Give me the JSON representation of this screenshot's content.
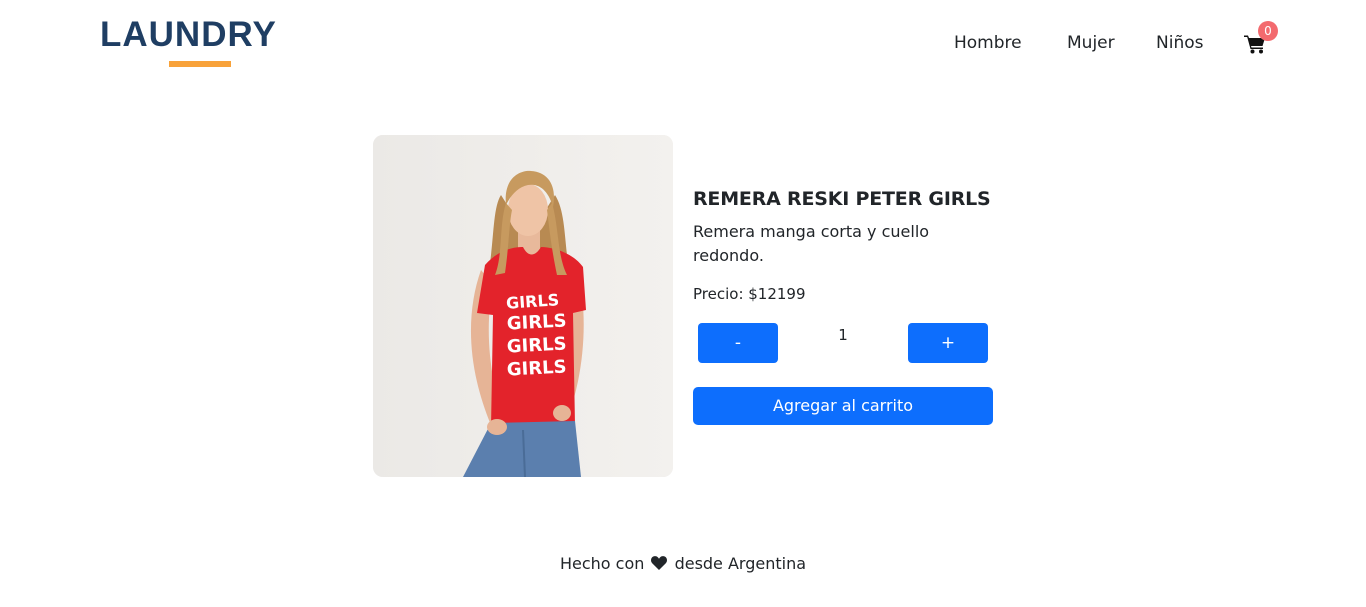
{
  "header": {
    "logo": "LAUNDRY",
    "nav": [
      "Hombre",
      "Mujer",
      "Niños"
    ],
    "cart_count": "0"
  },
  "product": {
    "title": "REMERA RESKI PETER GIRLS",
    "description": "Remera manga corta y cuello redondo.",
    "price": "Precio: $12199",
    "shirt_text": [
      "GIRLS",
      "GIRLS",
      "GIRLS",
      "GIRLS"
    ],
    "quantity": "1",
    "minus_label": "-",
    "plus_label": "+",
    "add_to_cart_label": "Agregar al carrito"
  },
  "footer": {
    "before_heart": "Hecho con",
    "after_heart": "desde Argentina"
  },
  "colors": {
    "primary": "#0d6efd",
    "logo": "#1f3e63",
    "logo_accent": "#f8a23a",
    "badge": "#f36a6e"
  }
}
